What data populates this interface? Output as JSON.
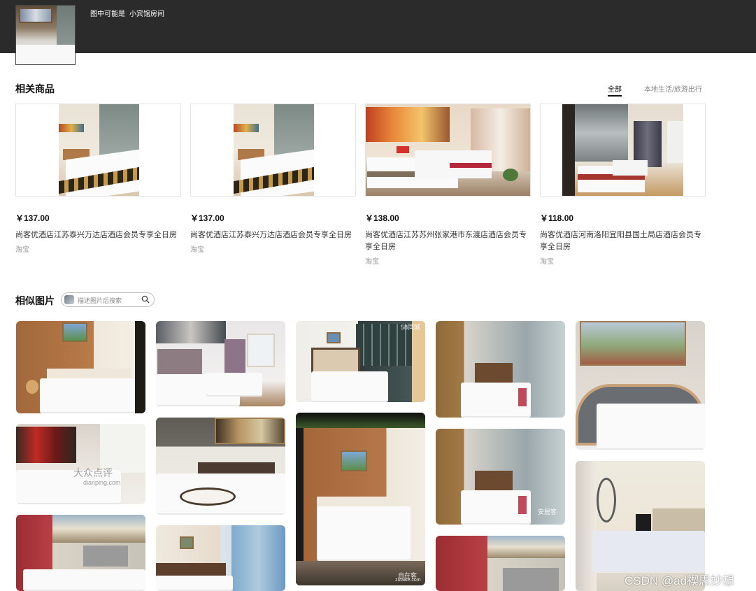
{
  "header": {
    "guess_label": "图中可能是",
    "guess_value": "小宾馆房间"
  },
  "products_section": {
    "title": "相关商品",
    "filters": [
      "全部",
      "本地生活/旅游出行"
    ],
    "active_filter": "全部",
    "items": [
      {
        "price": "￥137.00",
        "name": "尚客优酒店江苏泰兴万达店酒店会员专享全日房",
        "source": "淘宝"
      },
      {
        "price": "￥137.00",
        "name": "尚客优酒店江苏泰兴万达店酒店会员专享全日房",
        "source": "淘宝"
      },
      {
        "price": "￥138.00",
        "name": "尚客优酒店江苏苏州张家港市东渡店酒店会员专享全日房",
        "source": "淘宝"
      },
      {
        "price": "￥118.00",
        "name": "尚客优酒店河南洛阳宜阳县国土局店酒店会员专享全日房",
        "source": "淘宝"
      }
    ]
  },
  "similar_section": {
    "title": "相似图片",
    "search_placeholder": "描述图片后搜索",
    "watermarks": [
      "58同城",
      "大众点评",
      "dianping.com",
      "安居客",
      "自在客",
      "zizaike.com"
    ]
  },
  "footer_watermark": "CSDN @ad禊思妙想",
  "colors": {
    "topbar": "#2b2b2b",
    "accent_text": "#111111",
    "muted": "#888888"
  },
  "icons": {
    "search": "search-icon",
    "image_thumb": "image-icon"
  }
}
